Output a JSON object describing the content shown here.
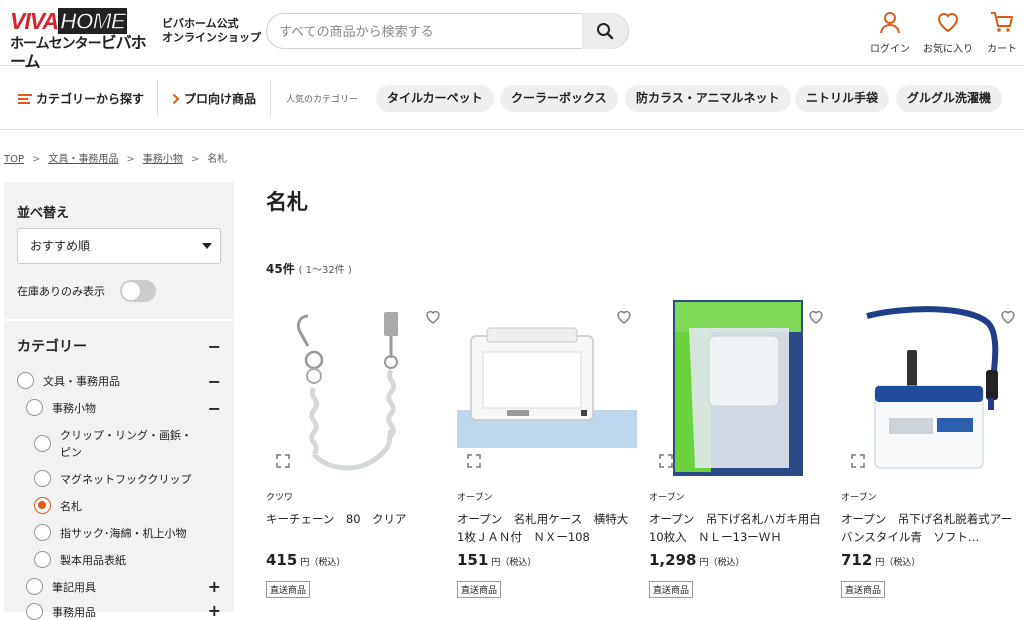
{
  "header": {
    "logo_top_a": "VIVA",
    "logo_top_b": "HOME",
    "logo_bottom_a": "ホームセンター",
    "logo_bottom_b": "ビバホーム",
    "store_line1": "ビバホーム公式",
    "store_line2": "オンラインショップ",
    "search_placeholder": "すべての商品から検索する",
    "login_label": "ログイン",
    "favorites_label": "お気に入り",
    "cart_label": "カート",
    "accent_color": "#e25a14"
  },
  "nav": {
    "category_label": "カテゴリーから探す",
    "pro_label": "プロ向け商品",
    "popular_label": "人気のカテゴリー",
    "chips": [
      "タイルカーペット",
      "クーラーボックス",
      "防カラス・アニマルネット",
      "ニトリル手袋",
      "グルグル洗濯機"
    ]
  },
  "breadcrumb": {
    "items": [
      "TOP",
      "文具・事務用品",
      "事務小物"
    ],
    "current": "名札"
  },
  "sidebar": {
    "sort_title": "並べ替え",
    "sort_value": "おすすめ順",
    "stock_only_label": "在庫ありのみ表示",
    "stock_only_on": false,
    "category_title": "カテゴリー",
    "categories": [
      {
        "label": "文具・事務用品",
        "level": 0,
        "toggle": "−"
      },
      {
        "label": "事務小物",
        "level": 1,
        "toggle": "−"
      },
      {
        "label": "クリップ・リング・画鋲・",
        "label2": "ピン",
        "level": 2
      },
      {
        "label": "マグネットフッククリップ",
        "level": 2
      },
      {
        "label": "名札",
        "level": 2,
        "selected": true
      },
      {
        "label": "指サック･海綿・机上小物",
        "level": 2
      },
      {
        "label": "製本用品表紙",
        "level": 2
      },
      {
        "label": "筆記用具",
        "level": 1,
        "toggle": "+"
      },
      {
        "label": "事務用品",
        "level": 1,
        "toggle": "+"
      }
    ]
  },
  "main": {
    "title": "名札",
    "count": "45件",
    "range": "( 1〜32件 )",
    "products": [
      {
        "brand": "クツワ",
        "name": "キーチェーン　80　クリア",
        "price": "415",
        "yen": "円（税込）",
        "badge": "直送商品",
        "image": "coiled-keychain"
      },
      {
        "brand": "オープン",
        "name": "オープン　名札用ケース　横特大　1枚ＪＡＮ付　ＮＸー108",
        "price": "151",
        "yen": "円（税込）",
        "badge": "直送商品",
        "image": "name-card-case"
      },
      {
        "brand": "オープン",
        "name": "オープン　吊下げ名札ハガキ用白10枚入　ＮＬー13ーＷＨ",
        "price": "1,298",
        "yen": "円（税込）",
        "badge": "直送商品",
        "image": "hanging-badge-pack"
      },
      {
        "brand": "オープン",
        "name": "オープン　吊下げ名札脱着式アーバンスタイル青　ソフト…",
        "price": "712",
        "yen": "円（税込）",
        "badge": "直送商品",
        "image": "lanyard-badge-blue"
      }
    ]
  }
}
